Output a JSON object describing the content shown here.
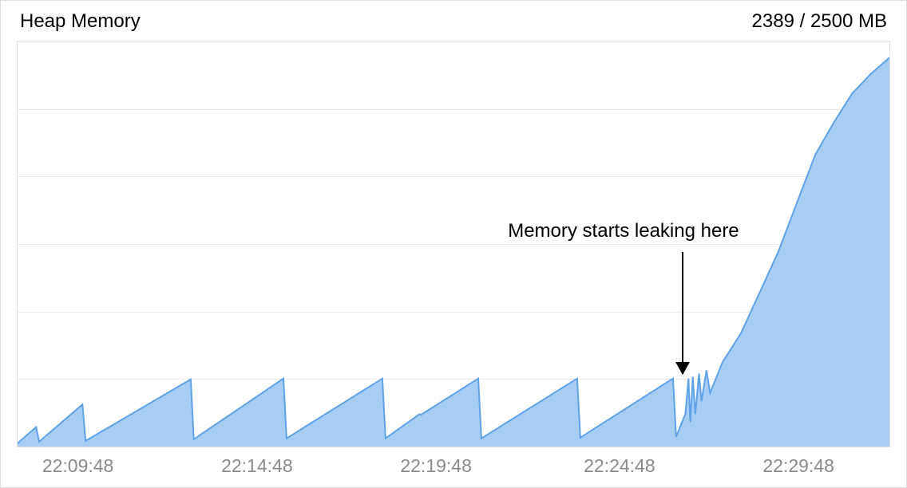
{
  "header": {
    "title": "Heap Memory",
    "value": "2389 / 2500 MB"
  },
  "annotation": {
    "text": "Memory starts leaking here",
    "x_position_pct": 69.5,
    "arrow_x_pct": 76.3
  },
  "x_axis": {
    "labels": [
      {
        "text": "22:09:48",
        "pct": 7.0
      },
      {
        "text": "22:14:48",
        "pct": 27.5
      },
      {
        "text": "22:19:48",
        "pct": 48.0
      },
      {
        "text": "22:24:48",
        "pct": 69.0
      },
      {
        "text": "22:29:48",
        "pct": 89.5
      }
    ]
  },
  "gridlines": {
    "horizontal_count": 6
  },
  "colors": {
    "fill": "#a7cdf5",
    "stroke": "#5da2e8",
    "grid": "#e9e9e9",
    "border": "#e0e0e0"
  },
  "chart_data": {
    "type": "area",
    "title": "Heap Memory",
    "ylabel": "MB",
    "ylim": [
      0,
      2500
    ],
    "x_start": "22:08:00",
    "x_end": "22:31:30",
    "annotation": "Memory starts leaking here at ~22:26:00",
    "series": [
      {
        "name": "heap_mb",
        "points": [
          {
            "t": "22:08:00",
            "v": 20
          },
          {
            "t": "22:08:30",
            "v": 120
          },
          {
            "t": "22:08:35",
            "v": 30
          },
          {
            "t": "22:09:45",
            "v": 260
          },
          {
            "t": "22:09:50",
            "v": 35
          },
          {
            "t": "22:12:40",
            "v": 415
          },
          {
            "t": "22:12:45",
            "v": 45
          },
          {
            "t": "22:15:10",
            "v": 420
          },
          {
            "t": "22:15:15",
            "v": 50
          },
          {
            "t": "22:17:50",
            "v": 420
          },
          {
            "t": "22:17:55",
            "v": 50
          },
          {
            "t": "22:18:50",
            "v": 200
          },
          {
            "t": "22:18:52",
            "v": 195
          },
          {
            "t": "22:20:25",
            "v": 420
          },
          {
            "t": "22:20:30",
            "v": 50
          },
          {
            "t": "22:23:05",
            "v": 420
          },
          {
            "t": "22:23:10",
            "v": 55
          },
          {
            "t": "22:25:40",
            "v": 420
          },
          {
            "t": "22:25:45",
            "v": 60
          },
          {
            "t": "22:26:00",
            "v": 200
          },
          {
            "t": "22:26:05",
            "v": 420
          },
          {
            "t": "22:26:08",
            "v": 150
          },
          {
            "t": "22:26:12",
            "v": 430
          },
          {
            "t": "22:26:16",
            "v": 200
          },
          {
            "t": "22:26:22",
            "v": 450
          },
          {
            "t": "22:26:26",
            "v": 280
          },
          {
            "t": "22:26:34",
            "v": 470
          },
          {
            "t": "22:26:40",
            "v": 330
          },
          {
            "t": "22:27:00",
            "v": 520
          },
          {
            "t": "22:27:30",
            "v": 700
          },
          {
            "t": "22:28:00",
            "v": 950
          },
          {
            "t": "22:28:30",
            "v": 1200
          },
          {
            "t": "22:29:00",
            "v": 1500
          },
          {
            "t": "22:29:30",
            "v": 1800
          },
          {
            "t": "22:30:00",
            "v": 2000
          },
          {
            "t": "22:30:30",
            "v": 2180
          },
          {
            "t": "22:31:00",
            "v": 2300
          },
          {
            "t": "22:31:30",
            "v": 2400
          }
        ]
      }
    ]
  }
}
